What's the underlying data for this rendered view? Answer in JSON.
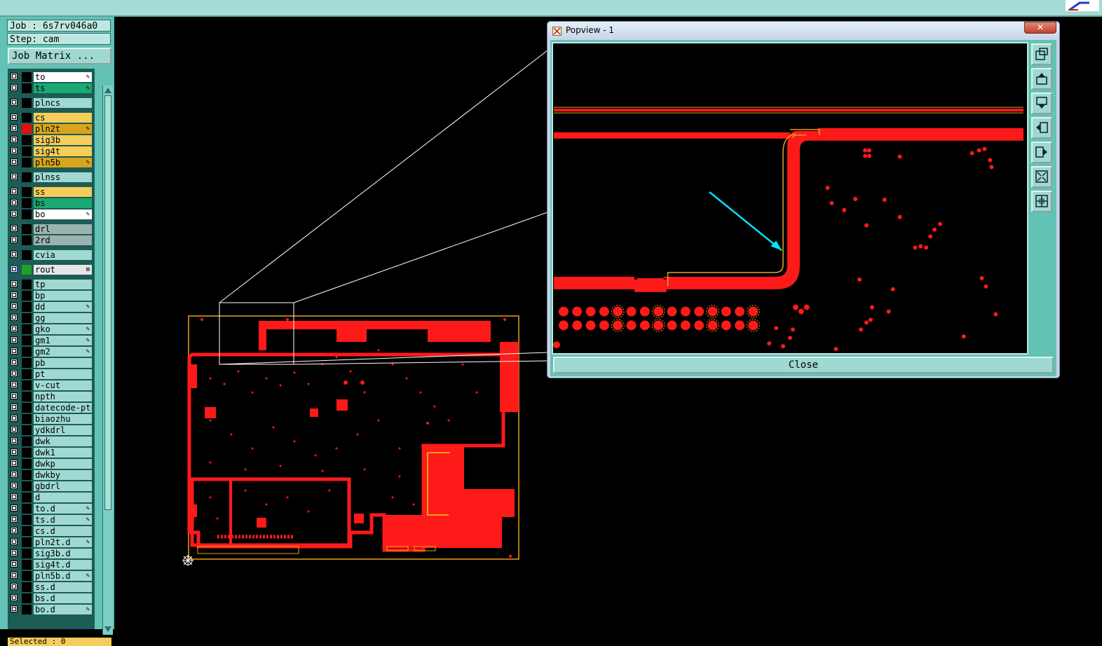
{
  "header": {
    "job_label": "Job : 6s7rv046a0",
    "step_label": "Step: cam",
    "job_matrix_button": "Job Matrix ..."
  },
  "layers": [
    {
      "name": "to",
      "bg": "#ffffff",
      "swatch": "#000000",
      "mark": "✎"
    },
    {
      "name": "ts",
      "bg": "#1aa874",
      "swatch": "#000000",
      "mark": "✎"
    },
    {
      "name": "plncs",
      "bg": "#9fd9d2",
      "swatch": "#000000",
      "mark": ""
    },
    {
      "name": "cs",
      "bg": "#f5cd5b",
      "swatch": "#000000",
      "mark": ""
    },
    {
      "name": "pln2t",
      "bg": "#d9a51c",
      "swatch": "#e01010",
      "mark": "✎"
    },
    {
      "name": "sig3b",
      "bg": "#f5cd5b",
      "swatch": "#000000",
      "mark": ""
    },
    {
      "name": "sig4t",
      "bg": "#f5cd5b",
      "swatch": "#000000",
      "mark": ""
    },
    {
      "name": "pln5b",
      "bg": "#d9a51c",
      "swatch": "#000000",
      "mark": "✎"
    },
    {
      "name": "plnss",
      "bg": "#9fd9d2",
      "swatch": "#000000",
      "mark": ""
    },
    {
      "name": "ss",
      "bg": "#f5cd5b",
      "swatch": "#000000",
      "mark": ""
    },
    {
      "name": "bs",
      "bg": "#1aa874",
      "swatch": "#000000",
      "mark": ""
    },
    {
      "name": "bo",
      "bg": "#ffffff",
      "swatch": "#000000",
      "mark": "✎"
    },
    {
      "name": "drl",
      "bg": "#9bb3b0",
      "swatch": "#000000",
      "mark": ""
    },
    {
      "name": "2rd",
      "bg": "#9bb3b0",
      "swatch": "#000000",
      "mark": ""
    },
    {
      "name": "cvia",
      "bg": "#9fd9d2",
      "swatch": "#000000",
      "mark": ""
    },
    {
      "name": "rout",
      "bg": "#e6e6e6",
      "swatch": "#22a02a",
      "mark": "⊞"
    },
    {
      "name": "tp",
      "bg": "#9fd9d2",
      "swatch": "#000000",
      "mark": ""
    },
    {
      "name": "bp",
      "bg": "#9fd9d2",
      "swatch": "#000000",
      "mark": ""
    },
    {
      "name": "dd",
      "bg": "#9fd9d2",
      "swatch": "#000000",
      "mark": "✎"
    },
    {
      "name": "gg",
      "bg": "#9fd9d2",
      "swatch": "#000000",
      "mark": ""
    },
    {
      "name": "gko",
      "bg": "#9fd9d2",
      "swatch": "#000000",
      "mark": "✎"
    },
    {
      "name": "gm1",
      "bg": "#9fd9d2",
      "swatch": "#000000",
      "mark": "✎"
    },
    {
      "name": "gm2",
      "bg": "#9fd9d2",
      "swatch": "#000000",
      "mark": "✎"
    },
    {
      "name": "pb",
      "bg": "#9fd9d2",
      "swatch": "#000000",
      "mark": ""
    },
    {
      "name": "pt",
      "bg": "#9fd9d2",
      "swatch": "#000000",
      "mark": ""
    },
    {
      "name": "v-cut",
      "bg": "#9fd9d2",
      "swatch": "#000000",
      "mark": ""
    },
    {
      "name": "npth",
      "bg": "#9fd9d2",
      "swatch": "#000000",
      "mark": ""
    },
    {
      "name": "datecode-ptc",
      "bg": "#9fd9d2",
      "swatch": "#000000",
      "mark": ""
    },
    {
      "name": "biaozhu",
      "bg": "#9fd9d2",
      "swatch": "#000000",
      "mark": ""
    },
    {
      "name": "ydkdrl",
      "bg": "#9fd9d2",
      "swatch": "#000000",
      "mark": ""
    },
    {
      "name": "dwk",
      "bg": "#9fd9d2",
      "swatch": "#000000",
      "mark": ""
    },
    {
      "name": "dwk1",
      "bg": "#9fd9d2",
      "swatch": "#000000",
      "mark": ""
    },
    {
      "name": "dwkp",
      "bg": "#9fd9d2",
      "swatch": "#000000",
      "mark": ""
    },
    {
      "name": "dwkby",
      "bg": "#9fd9d2",
      "swatch": "#000000",
      "mark": ""
    },
    {
      "name": "gbdrl",
      "bg": "#9fd9d2",
      "swatch": "#000000",
      "mark": ""
    },
    {
      "name": "d",
      "bg": "#9fd9d2",
      "swatch": "#000000",
      "mark": ""
    },
    {
      "name": "to.d",
      "bg": "#9fd9d2",
      "swatch": "#000000",
      "mark": "✎"
    },
    {
      "name": "ts.d",
      "bg": "#9fd9d2",
      "swatch": "#000000",
      "mark": "✎"
    },
    {
      "name": "cs.d",
      "bg": "#9fd9d2",
      "swatch": "#000000",
      "mark": ""
    },
    {
      "name": "pln2t.d",
      "bg": "#9fd9d2",
      "swatch": "#000000",
      "mark": "✎"
    },
    {
      "name": "sig3b.d",
      "bg": "#9fd9d2",
      "swatch": "#000000",
      "mark": ""
    },
    {
      "name": "sig4t.d",
      "bg": "#9fd9d2",
      "swatch": "#000000",
      "mark": ""
    },
    {
      "name": "pln5b.d",
      "bg": "#9fd9d2",
      "swatch": "#000000",
      "mark": "✎"
    },
    {
      "name": "ss.d",
      "bg": "#9fd9d2",
      "swatch": "#000000",
      "mark": ""
    },
    {
      "name": "bs.d",
      "bg": "#9fd9d2",
      "swatch": "#000000",
      "mark": ""
    },
    {
      "name": "bo.d",
      "bg": "#9fd9d2",
      "swatch": "#000000",
      "mark": "✎"
    }
  ],
  "status": {
    "selected": "Selected : 0"
  },
  "popup": {
    "title": "Popview - 1",
    "close_x": "✕",
    "close_button": "Close"
  },
  "colors": {
    "panel": "#62c2b6",
    "copper": "#ff1a1a",
    "outline": "#e8a11a",
    "annotation": "#00e5ff"
  }
}
